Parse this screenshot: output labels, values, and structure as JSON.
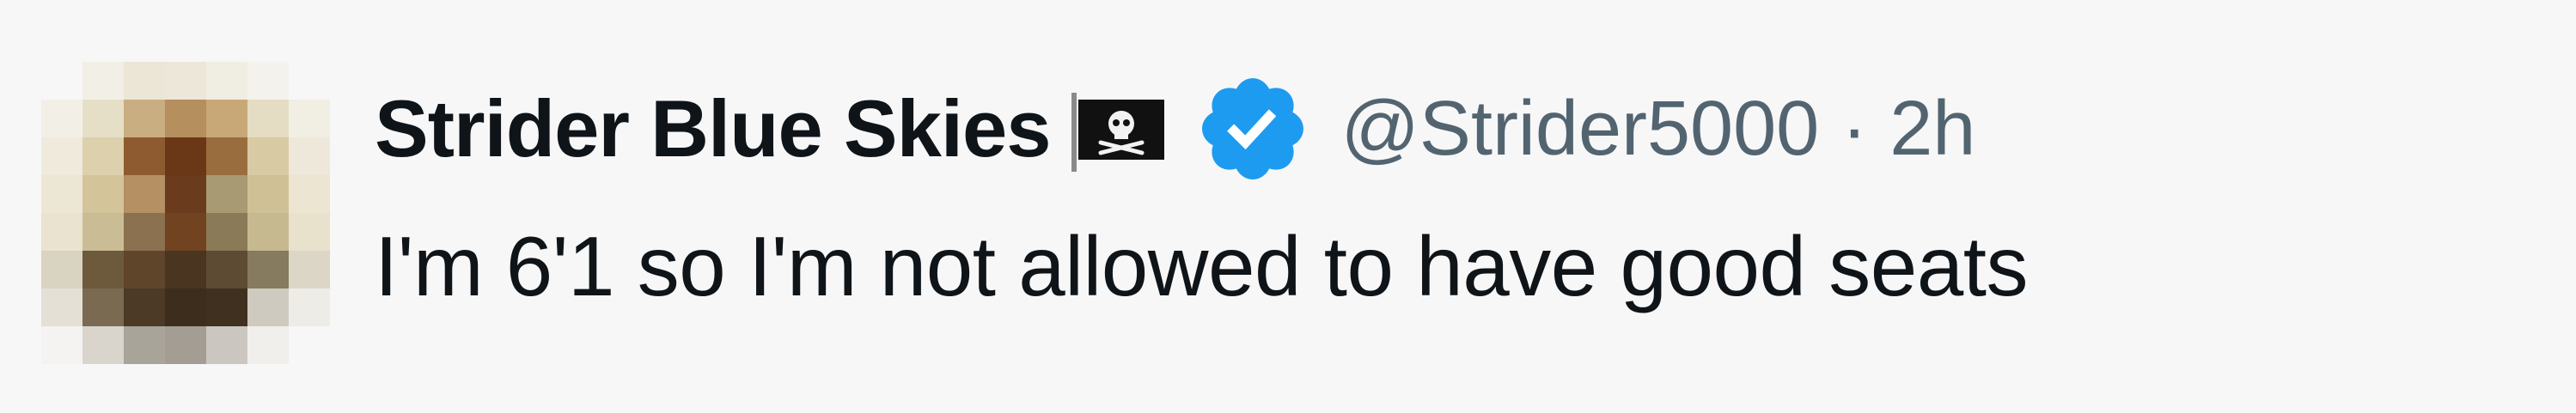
{
  "tweet": {
    "display_name": "Strider Blue Skies",
    "handle": "@Strider5000",
    "separator": "·",
    "timestamp": "2h",
    "text": "I'm 6'1 so I'm not allowed to have good seats"
  },
  "icons": {
    "flag": "pirate-flag-icon",
    "verified": "verified-badge-icon"
  },
  "colors": {
    "name": "#0f1419",
    "secondary": "#536471",
    "verified": "#1d9bf0",
    "background": "#f7f7f7"
  }
}
